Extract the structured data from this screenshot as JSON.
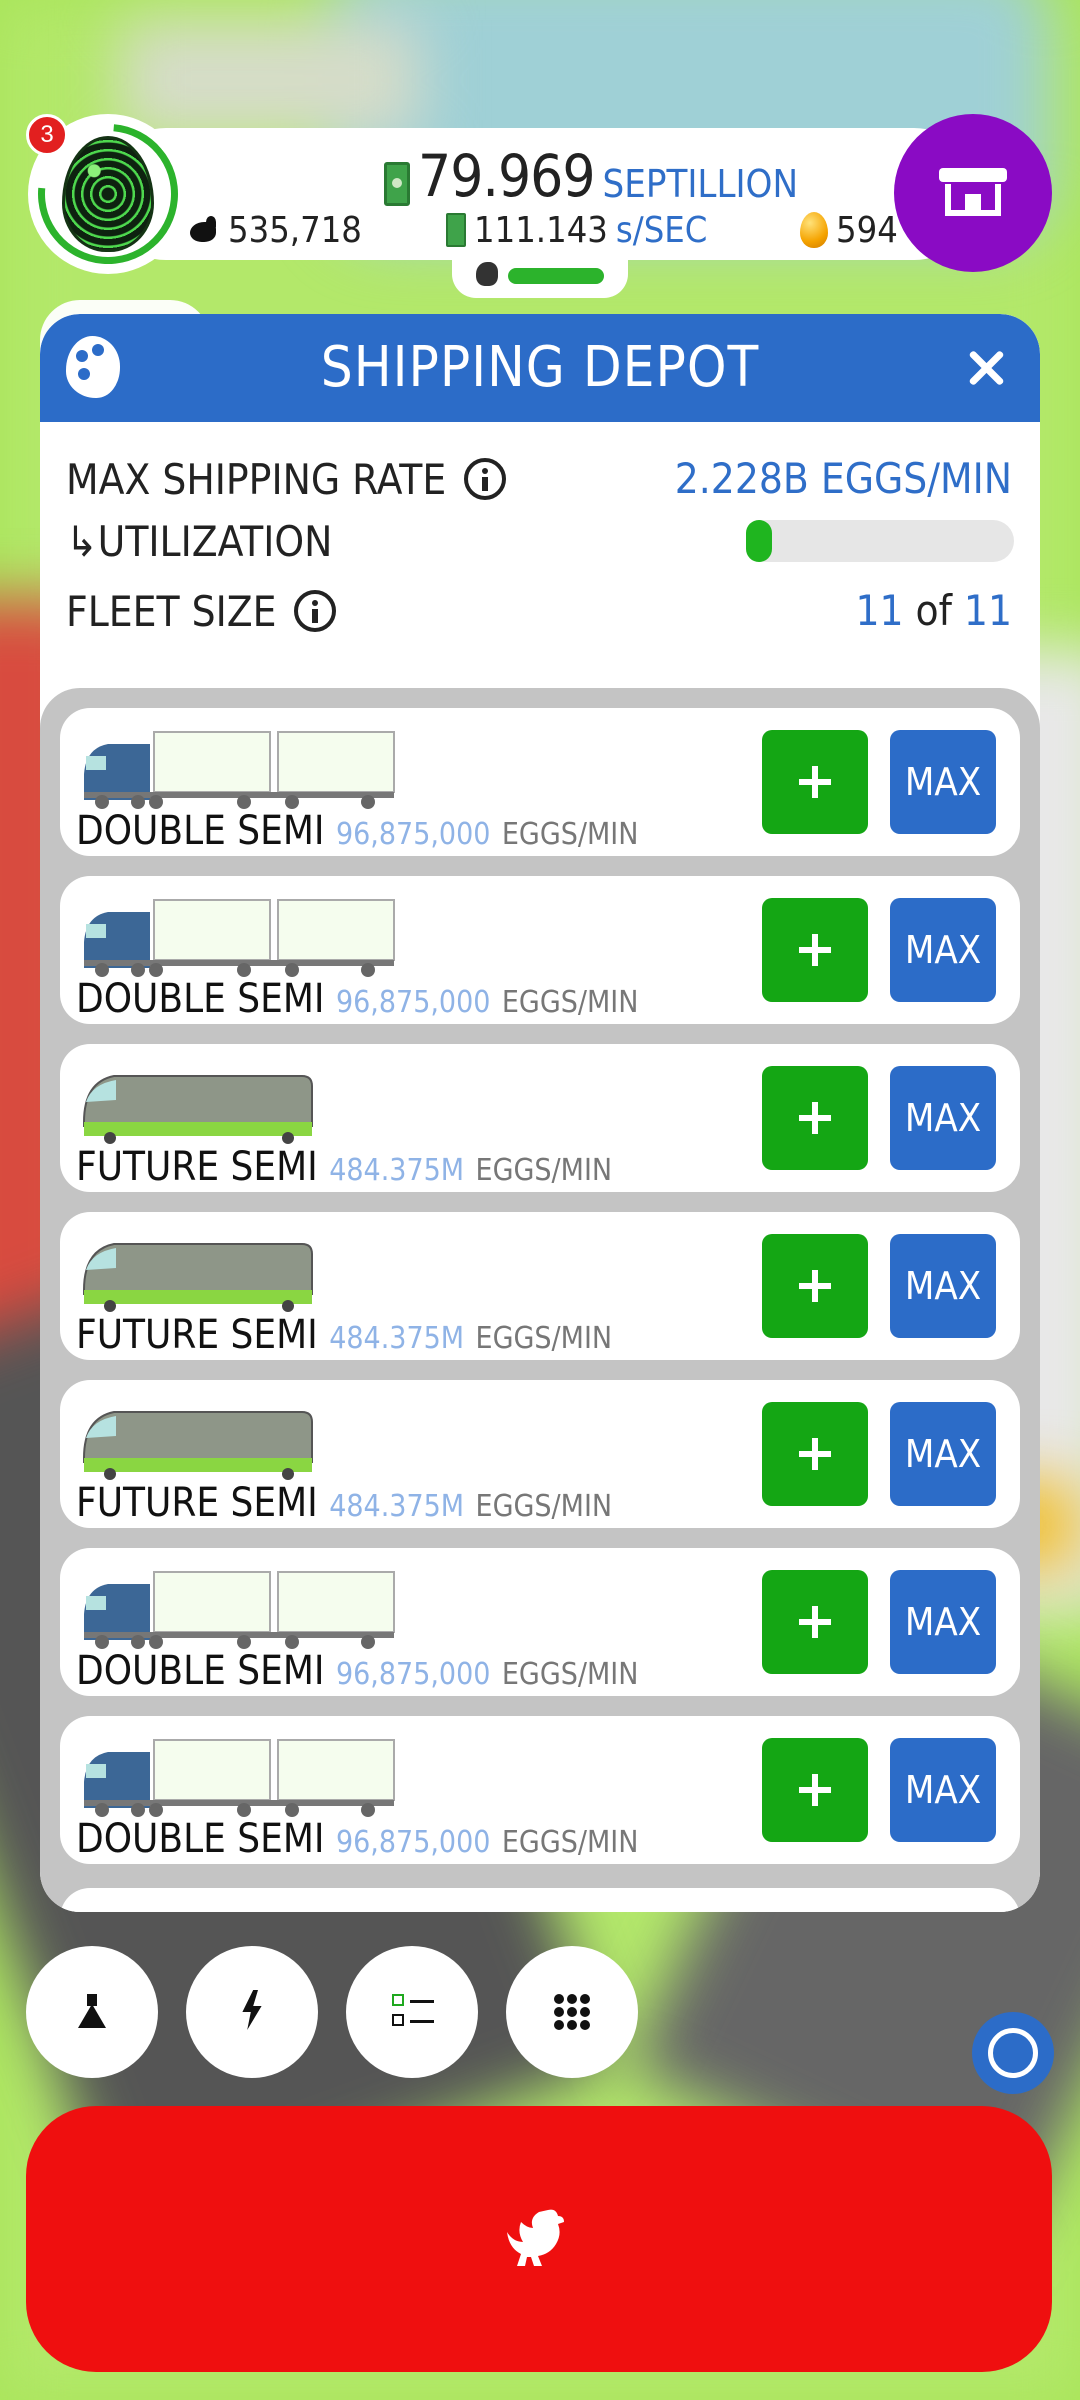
{
  "hud": {
    "prestige_count": "3",
    "money_value": "79.969",
    "money_unit": "SEPTILLION",
    "chickens": "535,718",
    "earning_rate_value": "111.143",
    "earning_rate_unit": "s/SEC",
    "golden_eggs": "594"
  },
  "panel": {
    "title": "SHIPPING DEPOT",
    "max_shipping_rate_label": "MAX SHIPPING RATE",
    "max_shipping_rate_value": "2.228B EGGS/MIN",
    "utilization_label": "↳UTILIZATION",
    "utilization_fraction": 0.04,
    "fleet_size_label": "FLEET SIZE",
    "fleet_size_current": "11",
    "fleet_size_of": "of",
    "fleet_size_max": "11"
  },
  "fleet": [
    {
      "name": "DOUBLE SEMI",
      "rate": "96,875,000",
      "unit": "EGGS/MIN",
      "plus": "+",
      "max": "MAX"
    },
    {
      "name": "DOUBLE SEMI",
      "rate": "96,875,000",
      "unit": "EGGS/MIN",
      "plus": "+",
      "max": "MAX"
    },
    {
      "name": "FUTURE SEMI",
      "rate": "484.375M",
      "unit": "EGGS/MIN",
      "plus": "+",
      "max": "MAX"
    },
    {
      "name": "FUTURE SEMI",
      "rate": "484.375M",
      "unit": "EGGS/MIN",
      "plus": "+",
      "max": "MAX"
    },
    {
      "name": "FUTURE SEMI",
      "rate": "484.375M",
      "unit": "EGGS/MIN",
      "plus": "+",
      "max": "MAX"
    },
    {
      "name": "DOUBLE SEMI",
      "rate": "96,875,000",
      "unit": "EGGS/MIN",
      "plus": "+",
      "max": "MAX"
    },
    {
      "name": "DOUBLE SEMI",
      "rate": "96,875,000",
      "unit": "EGGS/MIN",
      "plus": "+",
      "max": "MAX"
    }
  ],
  "icons": {
    "shop": "shop-icon",
    "palette": "palette-icon",
    "close": "close-icon",
    "info": "info-icon",
    "research": "flask-icon",
    "boosts": "lightning-icon",
    "missions": "checklist-icon",
    "menu": "grid-icon",
    "hatch": "chicken-icon"
  },
  "colors": {
    "header_blue": "#2c6cc8",
    "plus_green": "#14a614",
    "hatch_red": "#ef0f0f",
    "shop_purple": "#8a0bc4"
  }
}
